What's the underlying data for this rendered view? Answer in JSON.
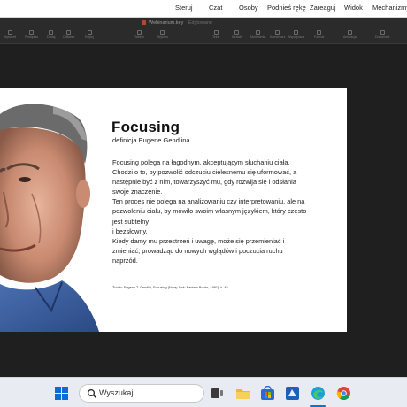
{
  "meeting_controls": {
    "items": [
      "Steruj",
      "Czat",
      "Osoby",
      "Podnieś rękę",
      "Zareaguj",
      "Widok",
      "Mechanizmy"
    ]
  },
  "app": {
    "window_title": "Webinarium.key",
    "window_subtitle": "Edytowane",
    "toolbar_items": [
      "Wyświetl",
      "Powiększ",
      "Dodaj",
      "Odtwórz",
      "Edytuj",
      "Tabela",
      "Wykres",
      "Tekst",
      "Kształt",
      "Multimedia",
      "Komentarz",
      "Współpraca",
      "Format",
      "Animacja",
      "Dokument"
    ]
  },
  "slide": {
    "title": "Focusing",
    "subtitle": "definicja Eugene Gendlina",
    "body_lines": [
      "Focusing polega na łagodnym, akceptującym słuchaniu ciała.",
      "Chodzi o to, by pozwolić odczuciu cielesnemu się uformować, a",
      "następnie być z nim, towarzyszyć mu, gdy rozwija się i odsłania",
      "swoje znaczenie.",
      "Ten proces nie polega na analizowaniu czy interpretowaniu, ale na",
      "pozwoleniu ciału, by mówiło swoim własnym językiem, który często",
      "jest subtelny",
      "i bezsłowny.",
      "Kiedy damy mu przestrzeń i uwagę, może się przemieniać i",
      "zmieniać, prowadząc do nowych wglądów i poczucia ruchu",
      "naprzód."
    ],
    "source": "Źródło: Eugene T. Gendlin, Focusing (Nowy Jork: Bantam Books, 1981), s. 45."
  },
  "taskbar": {
    "search_placeholder": "Wyszukaj",
    "icons": [
      "windows-start-icon",
      "task-view-icon",
      "file-explorer-icon",
      "store-icon",
      "office-icon",
      "edge-icon",
      "chrome-icon"
    ]
  },
  "colors": {
    "toolbar_bg": "#2b2b2b",
    "stage_bg": "#1f1f1f",
    "taskbar_bg": "#e8ecf2",
    "accent_blue": "#0078d4"
  }
}
